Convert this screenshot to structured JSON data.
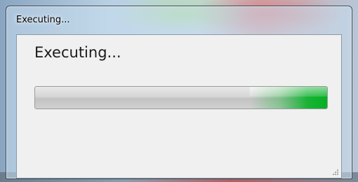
{
  "window": {
    "title": "Executing...",
    "message": "Executing..."
  },
  "progress": {
    "value": 1.0,
    "style": "marquee",
    "color": "#06b025"
  },
  "icons": {
    "grip": "resize-grip-icon"
  }
}
